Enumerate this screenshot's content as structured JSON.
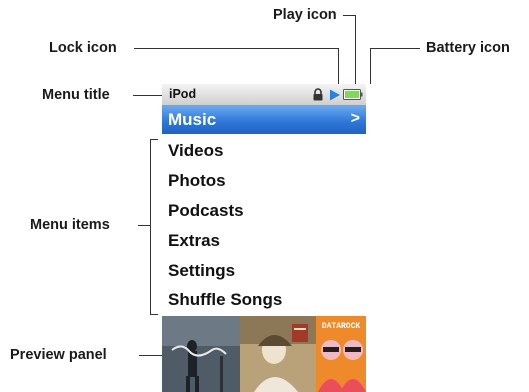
{
  "callouts": {
    "play_icon": "Play icon",
    "lock_icon": "Lock icon",
    "battery_icon": "Battery icon",
    "menu_title": "Menu title",
    "menu_items": "Menu items",
    "preview_panel": "Preview panel"
  },
  "ipod": {
    "title": "iPod",
    "selected_item": "Music",
    "selected_chevron": ">",
    "items": [
      "Videos",
      "Photos",
      "Podcasts",
      "Extras",
      "Settings",
      "Shuffle Songs"
    ],
    "preview_album_3_text": "DATAROCK"
  },
  "colors": {
    "selection_blue": "#2f78d8",
    "play_blue": "#2f7fe0",
    "battery_green": "#7ed957"
  }
}
